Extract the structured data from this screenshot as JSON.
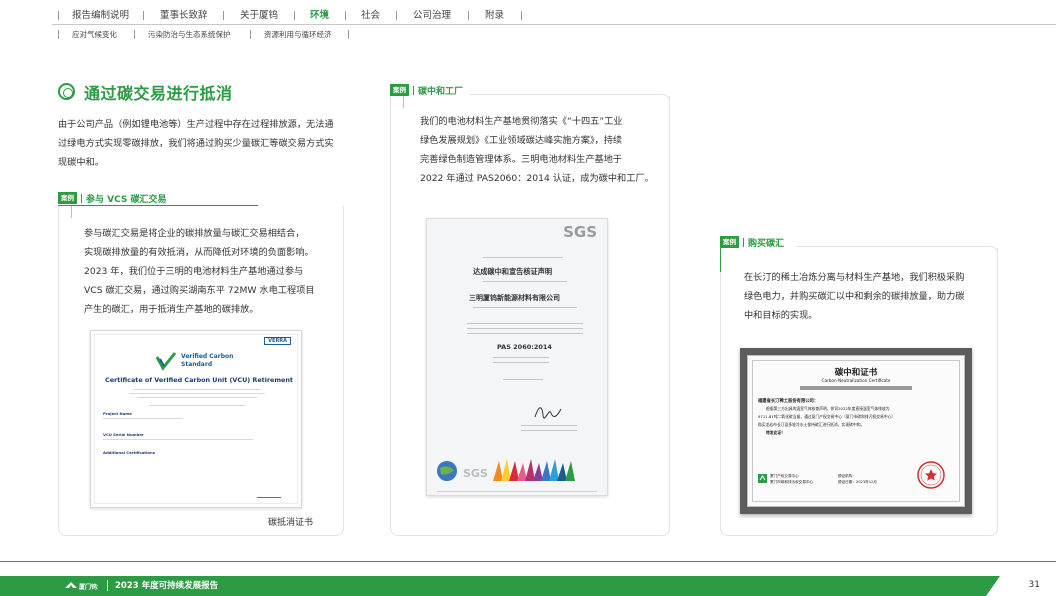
{
  "nav": {
    "items": [
      "报告编制说明",
      "董事长致辞",
      "关于厦钨",
      "环境",
      "社会",
      "公司治理",
      "附录"
    ],
    "active_index": 3
  },
  "subnav": {
    "items": [
      "应对气候变化",
      "污染防治与生态系统保护",
      "资源利用与循环经济"
    ]
  },
  "section": {
    "title": "通过碳交易进行抵消",
    "intro": [
      "由于公司产品（例如锂电池等）生产过程中存在过程排放源，无法通",
      "过绿电方式实现零碳排放，我们将通过购买少量碳汇等碳交易方式实",
      "现碳中和。"
    ]
  },
  "case_label": "案例",
  "case1": {
    "title": "参与 VCS 碳汇交易",
    "body": [
      "参与碳汇交易是将企业的碳排放量与碳汇交易相结合，",
      "实现碳排放量的有效抵消，从而降低对环境的负面影响。",
      "2023 年，我们位于三明的电池材料生产基地通过参与",
      "VCS 碳汇交易，通过购买湖南东平 72MW 水电工程项目",
      "产生的碳汇，用于抵消生产基地的碳排放。"
    ],
    "caption": "碳抵消证书",
    "cert": {
      "brand": "VERRA",
      "vc_line1": "Verified Carbon",
      "vc_line2": "Standard",
      "title": "Certificate of Verified Carbon Unit (VCU) Retirement",
      "project_label": "Project Name",
      "serial_label": "VCU Serial Number",
      "additional_label": "Additional Certifications"
    }
  },
  "case2": {
    "title": "碳中和工厂",
    "body": [
      "我们的电池材料生产基地贯彻落实《“十四五”工业",
      "绿色发展规划》《工业领域碳达峰实施方案》，持续",
      "完善绿色制造管理体系。三明电池材料生产基地于",
      "2022 年通过 PAS2060：2014 认证，成为碳中和工厂。"
    ],
    "cert": {
      "logo": "SGS",
      "title": "达成碳中和宣告核证声明",
      "company": "三明厦钨新能源材料有限公司",
      "standard": "PAS 2060:2014"
    }
  },
  "case3": {
    "title": "购买碳汇",
    "body": [
      "在长汀的稀土冶炼分离与材料生产基地，我们积极采购",
      "绿色电力，并购买碳汇以中和剩余的碳排放量，助力碳",
      "中和目标的实现。"
    ],
    "cert": {
      "title": "碳中和证书",
      "subtitle": "Carbon Neutralization Certificate",
      "recipient": "福建省长汀稀土股份有限公司：",
      "body": [
        "根据第三方出具的温室气体核查声明，你司2022年度直接温室气体排放为",
        "9711.81吨二氧化碳当量，通过厦门产权交易中心（厦门市碳和排污权交易中心）",
        "购买龙岩市长汀县多轮冷水土保持碳汇进行抵消，实现碳中和。",
        "特发此证！"
      ],
      "issuer": "厦门产权交易中心",
      "issuer2": "厦门市碳和排污权交易中心",
      "issuer_label": "颁证机构：",
      "date": "颁证日期：2023年12月"
    }
  },
  "footer": {
    "logo_text": "厦门钨业",
    "report_title": "2023 年度可持续发展报告",
    "page": "31"
  },
  "colors": {
    "brand_green": "#2c9b44",
    "light_green": "#9fd2aa"
  }
}
